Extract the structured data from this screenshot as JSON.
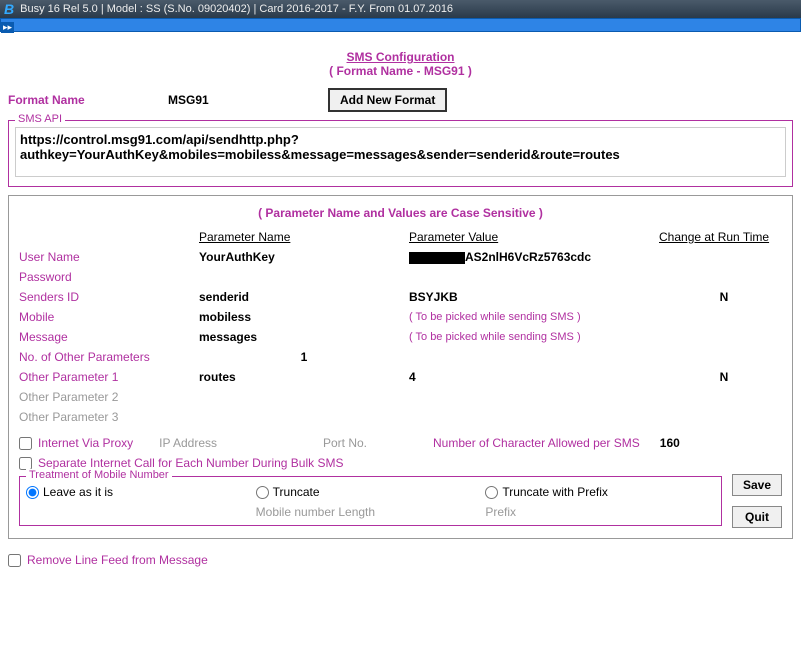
{
  "titlebar": {
    "logo": "B",
    "text": "Busy 16  Rel 5.0  |  Model : SS (S.No. 09020402)  |  Card 2016-2017 - F.Y. From 01.07.2016"
  },
  "header": {
    "title": "SMS Configuration",
    "subtitle": "( Format Name - MSG91 )"
  },
  "formatName": {
    "label": "Format Name",
    "value": "MSG91"
  },
  "addButton": "Add New Format",
  "smsApi": {
    "legend": "SMS API",
    "value": "https://control.msg91.com/api/sendhttp.php?authkey=YourAuthKey&mobiles=mobiless&message=messages&sender=senderid&route=routes"
  },
  "caseNote": "( Parameter Name and Values are Case Sensitive )",
  "cols": {
    "name": "Parameter Name",
    "value": "Parameter Value",
    "runtime": "Change at Run Time"
  },
  "rows": {
    "username": {
      "label": "User Name",
      "name": "YourAuthKey",
      "valueSuffix": "AS2nlH6VcRz5763cdc",
      "runtime": ""
    },
    "password": {
      "label": "Password",
      "name": "",
      "value": "",
      "runtime": ""
    },
    "sender": {
      "label": "Senders ID",
      "name": "senderid",
      "value": "BSYJKB",
      "runtime": "N"
    },
    "mobile": {
      "label": "Mobile",
      "name": "mobiless",
      "hint": "( To be picked while sending SMS )",
      "runtime": ""
    },
    "message": {
      "label": "Message",
      "name": "messages",
      "hint": "( To be picked while sending SMS )",
      "runtime": ""
    },
    "other": {
      "label": "No. of Other Parameters",
      "value": "1"
    },
    "op1": {
      "label": "Other Parameter 1",
      "name": "routes",
      "value": "4",
      "runtime": "N"
    },
    "op2": {
      "label": "Other Parameter 2"
    },
    "op3": {
      "label": "Other Parameter 3"
    }
  },
  "proxy": {
    "checkbox": "Internet Via Proxy",
    "ip": "IP Address",
    "port": "Port No."
  },
  "charAllowed": {
    "label": "Number of Character Allowed per SMS",
    "value": "160"
  },
  "bulk": "Separate Internet Call for Each Number During Bulk SMS",
  "treatment": {
    "legend": "Treatment of Mobile Number",
    "leave": "Leave as it is",
    "truncate": "Truncate",
    "truncatePrefix": "Truncate with Prefix",
    "mobLen": "Mobile number Length",
    "prefix": "Prefix"
  },
  "save": "Save",
  "quit": "Quit",
  "removeLF": "Remove Line Feed from Message"
}
